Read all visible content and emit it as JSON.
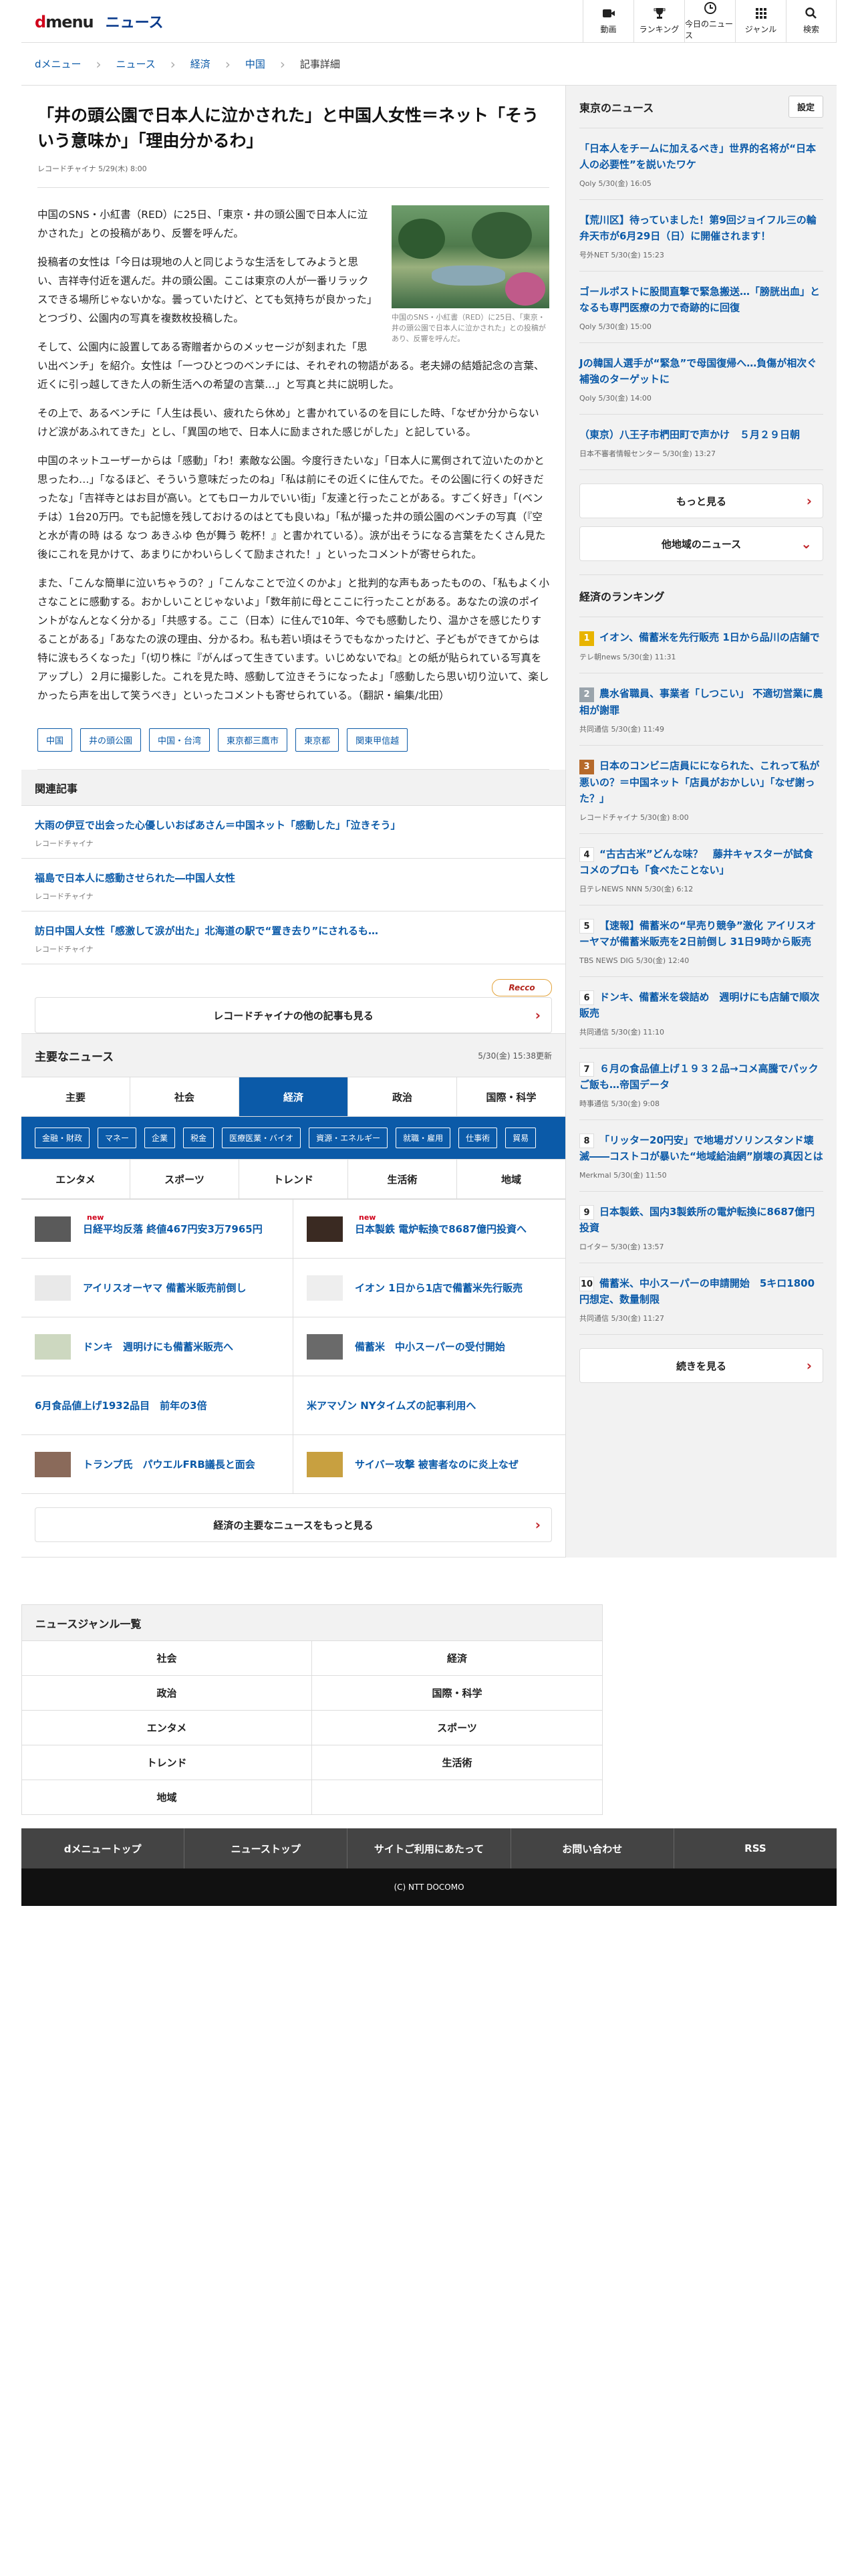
{
  "header": {
    "logo_d": "d",
    "logo_menu": "menu",
    "logo_news": "ニュース",
    "nav": [
      {
        "label": "動画",
        "icon": "video-icon"
      },
      {
        "label": "ランキング",
        "icon": "trophy-icon"
      },
      {
        "label": "今日のニュース",
        "icon": "clock-icon"
      },
      {
        "label": "ジャンル",
        "icon": "grid-icon"
      },
      {
        "label": "検索",
        "icon": "search-icon"
      }
    ]
  },
  "breadcrumb": [
    "dメニュー",
    "ニュース",
    "経済",
    "中国",
    "記事詳細"
  ],
  "article": {
    "title": "「井の頭公園で日本人に泣かされた」と中国人女性＝ネット「そういう意味か」「理由分かるわ」",
    "meta": "レコードチャイナ 5/29(木) 8:00",
    "caption": "中国のSNS・小紅書（RED）に25日、「東京・井の頭公園で日本人に泣かされた」との投稿があり、反響を呼んだ。",
    "paragraphs": [
      "中国のSNS・小紅書（RED）に25日、「東京・井の頭公園で日本人に泣かされた」との投稿があり、反響を呼んだ。",
      "投稿者の女性は「今日は現地の人と同じような生活をしてみようと思い、吉祥寺付近を選んだ。井の頭公園。ここは東京の人が一番リラックスできる場所じゃないかな。曇っていたけど、とても気持ちが良かった」とつづり、公園内の写真を複数枚投稿した。",
      "そして、公園内に設置してある寄贈者からのメッセージが刻まれた「思い出ベンチ」を紹介。女性は「一つひとつのベンチには、それぞれの物語がある。老夫婦の結婚記念の言葉、近くに引っ越してきた人の新生活への希望の言葉…」と写真と共に説明した。",
      "その上で、あるベンチに「人生は長い、疲れたら休め」と書かれているのを目にした時、「なぜか分からないけど涙があふれてきた」とし、「異国の地で、日本人に励まされた感じがした」と記している。",
      "中国のネットユーザーからは「感動」「わ！素敵な公園。今度行きたいな」「日本人に罵倒されて泣いたのかと思ったわ…」「なるほど、そういう意味だったのね」「私は前にその近くに住んでた。その公園に行くの好きだったな」「吉祥寺とはお目が高い。とてもローカルでいい街」「友達と行ったことがある。すごく好き」「(ベンチは）1台20万円。でも記憶を残しておけるのはとても良いね」「私が撮った井の頭公園のベンチの写真（『空と水が青の時 はる なつ あきふゆ 色が舞う 乾杯！』と書かれている）。涙が出そうになる言葉をたくさん見た後にこれを見かけて、あまりにかわいらしくて励まされた！」といったコメントが寄せられた。",
      "また、「こんな簡単に泣いちゃうの？」「こんなことで泣くのかよ」と批判的な声もあったものの、「私もよく小さなことに感動する。おかしいことじゃないよ」「数年前に母とここに行ったことがある。あなたの涙のポイントがなんとなく分かる」「共感する。ここ（日本）に住んで10年、今でも感動したり、温かさを感じたりすることがある」「あなたの涙の理由、分かるわ。私も若い頃はそうでもなかったけど、子どもができてからは特に涙もろくなった」「(切り株に『がんばって生きています。いじめないでね』との紙が貼られている写真をアップし）２月に撮影した。これを見た時、感動して泣きそうになったよ」「感動したら思い切り泣いて、楽しかったら声を出して笑うべき」といったコメントも寄せられている。（翻訳・編集/北田）"
    ],
    "tags": [
      "中国",
      "井の頭公園",
      "中国・台湾",
      "東京都三鷹市",
      "東京都",
      "関東甲信越"
    ]
  },
  "related": {
    "heading": "関連記事",
    "items": [
      {
        "title": "大雨の伊豆で出会った心優しいおばあさん＝中国ネット「感動した」「泣きそう」",
        "source": "レコードチャイナ"
      },
      {
        "title": "福島で日本人に感動させられた―中国人女性",
        "source": "レコードチャイナ"
      },
      {
        "title": "訪日中国人女性「感激して涙が出た」北海道の駅で“置き去り”にされるも…",
        "source": "レコードチャイナ"
      }
    ],
    "logo": "Recco",
    "more": "レコードチャイナの他の記事も見る"
  },
  "major": {
    "heading": "主要なニュース",
    "time": "5/30(金) 15:38更新",
    "tabs": [
      "主要",
      "社会",
      "経済",
      "政治",
      "国際・科学"
    ],
    "active_tab": "経済",
    "subtags": [
      "金融・財政",
      "マネー",
      "企業",
      "税金",
      "医療医業・バイオ",
      "資源・エネルギー",
      "就職・雇用",
      "仕事術",
      "貿易"
    ],
    "tabs2": [
      "エンタメ",
      "スポーツ",
      "トレンド",
      "生活術",
      "地域"
    ],
    "items": [
      {
        "title": "日経平均反落 終値467円安3万7965円",
        "new": "new",
        "thumb": true
      },
      {
        "title": "日本製鉄 電炉転換で8687億円投資へ",
        "new": "new",
        "thumb": true
      },
      {
        "title": "アイリスオーヤマ 備蓄米販売前倒し",
        "new": "",
        "thumb": true
      },
      {
        "title": "イオン 1日から1店で備蓄米先行販売",
        "new": "",
        "thumb": true
      },
      {
        "title": "ドンキ　週明けにも備蓄米販売へ",
        "new": "",
        "thumb": true
      },
      {
        "title": "備蓄米　中小スーパーの受付開始",
        "new": "",
        "thumb": true
      },
      {
        "title": "6月食品値上げ1932品目　前年の3倍",
        "new": "",
        "thumb": false
      },
      {
        "title": "米アマゾン NYタイムズの記事利用へ",
        "new": "",
        "thumb": false
      },
      {
        "title": "トランプ氏　パウエルFRB議長と面会",
        "new": "",
        "thumb": true
      },
      {
        "title": "サイバー攻撃 被害者なのに炎上なぜ",
        "new": "",
        "thumb": true
      }
    ],
    "more": "経済の主要なニュースをもっと見る"
  },
  "genres": {
    "heading": "ニュースジャンル一覧",
    "items": [
      "社会",
      "経済",
      "政治",
      "国際・科学",
      "エンタメ",
      "スポーツ",
      "トレンド",
      "生活術",
      "地域",
      ""
    ]
  },
  "footer": {
    "nav": [
      "dメニュートップ",
      "ニューストップ",
      "サイトご利用にあたって",
      "お問い合わせ",
      "RSS"
    ],
    "copyright": "(C) NTT DOCOMO"
  },
  "sidebar": {
    "local": {
      "heading": "東京のニュース",
      "settings": "設定",
      "items": [
        {
          "title": "「日本人をチームに加えるべき」世界的名将が“日本人の必要性”を説いたワケ",
          "source": "Qoly 5/30(金) 16:05"
        },
        {
          "title": "【荒川区】待っていました！第9回ジョイフル三の輪弁天市が6月29日（日）に開催されます！",
          "source": "号外NET 5/30(金) 15:23"
        },
        {
          "title": "ゴールポストに股間直撃で緊急搬送…「膀胱出血」となるも専門医療の力で奇跡的に回復",
          "source": "Qoly 5/30(金) 15:00"
        },
        {
          "title": "Jの韓国人選手が“緊急”で母国復帰へ…負傷が相次ぐ補強のターゲットに",
          "source": "Qoly 5/30(金) 14:00"
        },
        {
          "title": "（東京）八王子市椚田町で声かけ　５月２９日朝",
          "source": "日本不審者情報センター 5/30(金) 13:27"
        }
      ],
      "more": "もっと見る",
      "other": "他地域のニュース"
    },
    "ranking": {
      "heading": "経済のランキング",
      "items": [
        {
          "n": "1",
          "title": "イオン、備蓄米を先行販売 1日から品川の店舗で",
          "source": "テレ朝news 5/30(金) 11:31",
          "cls": "r1"
        },
        {
          "n": "2",
          "title": "農水省職員、事業者「しつこい」 不適切営業に農相が謝罪",
          "source": "共同通信 5/30(金) 11:49",
          "cls": "r2"
        },
        {
          "n": "3",
          "title": "日本のコンビニ店員にになられた、これって私が悪いの？＝中国ネット「店員がおかしい」「なぜ謝った？」",
          "source": "レコードチャイナ 5/30(金) 8:00",
          "cls": "r3"
        },
        {
          "n": "4",
          "title": "“古古古米”どんな味？　藤井キャスターが試食　コメのプロも「食べたことない」",
          "source": "日テレNEWS NNN 5/30(金) 6:12",
          "cls": "rx"
        },
        {
          "n": "5",
          "title": "【速報】備蓄米の“早売り競争”激化 アイリスオーヤマが備蓄米販売を2日前倒し 31日9時から販売",
          "source": "TBS NEWS DIG 5/30(金) 12:40",
          "cls": "rx"
        },
        {
          "n": "6",
          "title": "ドンキ、備蓄米を袋詰め　週明けにも店舗で順次販売",
          "source": "共同通信 5/30(金) 11:10",
          "cls": "rx"
        },
        {
          "n": "7",
          "title": "６月の食品値上げ１９３２品→コメ高騰でパックご飯も…帝国データ",
          "source": "時事通信 5/30(金) 9:08",
          "cls": "rx"
        },
        {
          "n": "8",
          "title": "「リッター20円安」で地場ガソリンスタンド壊滅――コストコが暴いた“地域給油網”崩壊の真因とは",
          "source": "Merkmal 5/30(金) 11:50",
          "cls": "rx"
        },
        {
          "n": "9",
          "title": "日本製鉄、国内3製鉄所の電炉転換に8687億円投資",
          "source": "ロイター 5/30(金) 13:57",
          "cls": "rx"
        },
        {
          "n": "10",
          "title": "備蓄米、中小スーパーの申請開始　5キロ1800円想定、数量制限",
          "source": "共同通信 5/30(金) 11:27",
          "cls": "rx"
        }
      ],
      "more": "続きを見る"
    }
  },
  "colors": {
    "accent": "#0b5aa8",
    "brand_red": "#d0021b"
  }
}
